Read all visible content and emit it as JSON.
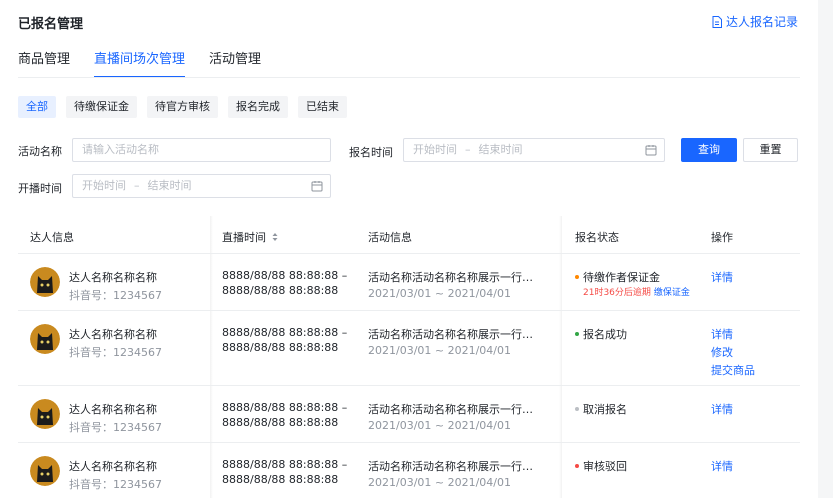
{
  "header": {
    "title": "已报名管理",
    "record_link": "达人报名记录"
  },
  "tabs": [
    {
      "label": "商品管理",
      "active": false
    },
    {
      "label": "直播间场次管理",
      "active": true
    },
    {
      "label": "活动管理",
      "active": false
    }
  ],
  "status_filters": [
    {
      "label": "全部",
      "active": true
    },
    {
      "label": "待缴保证金",
      "active": false
    },
    {
      "label": "待官方审核",
      "active": false
    },
    {
      "label": "报名完成",
      "active": false
    },
    {
      "label": "已结束",
      "active": false
    }
  ],
  "form": {
    "activity_name_label": "活动名称",
    "activity_name_placeholder": "请输入活动名称",
    "signup_time_label": "报名时间",
    "live_time_label": "开播时间",
    "start_placeholder": "开始时间",
    "end_placeholder": "结束时间",
    "range_sep": "–",
    "query_button": "查询",
    "reset_button": "重置"
  },
  "table": {
    "columns": {
      "influencer": "达人信息",
      "live_time": "直播时间",
      "activity": "活动信息",
      "status": "报名状态",
      "actions": "操作"
    },
    "rows": [
      {
        "name": "达人名称名称名称",
        "douyin_id": "抖音号：1234567",
        "time_start": "8888/88/88 88:88:88 –",
        "time_end": "8888/88/88 88:88:88",
        "activity_name": "活动名称活动名称名称展示一行…",
        "activity_date": "2021/03/01 ~ 2021/04/01",
        "status": "待缴作者保证金",
        "status_color": "#ff8800",
        "note_overdue": "21时36分后逾期",
        "note_link": "缴保证金",
        "actions": [
          "详情"
        ]
      },
      {
        "name": "达人名称名称名称",
        "douyin_id": "抖音号：1234567",
        "time_start": "8888/88/88 88:88:88 –",
        "time_end": "8888/88/88 88:88:88",
        "activity_name": "活动名称活动名称名称展示一行…",
        "activity_date": "2021/03/01 ~ 2021/04/01",
        "status": "报名成功",
        "status_color": "#32a645",
        "actions": [
          "详情",
          "修改",
          "提交商品"
        ]
      },
      {
        "name": "达人名称名称名称",
        "douyin_id": "抖音号：1234567",
        "time_start": "8888/88/88 88:88:88 –",
        "time_end": "8888/88/88 88:88:88",
        "activity_name": "活动名称活动名称名称展示一行…",
        "activity_date": "2021/03/01 ~ 2021/04/01",
        "status": "取消报名",
        "status_color": "#bbbfc4",
        "actions": [
          "详情"
        ]
      },
      {
        "name": "达人名称名称名称",
        "douyin_id": "抖音号：1234567",
        "time_start": "8888/88/88 88:88:88 –",
        "time_end": "8888/88/88 88:88:88",
        "activity_name": "活动名称活动名称名称展示一行…",
        "activity_date": "2021/03/01 ~ 2021/04/01",
        "status": "审核驳回",
        "status_color": "#f54a45",
        "actions": [
          "详情"
        ]
      }
    ]
  },
  "colors": {
    "brand": "#1966ff",
    "danger": "#f54a45",
    "warning": "#ff8800",
    "success": "#32a645"
  }
}
